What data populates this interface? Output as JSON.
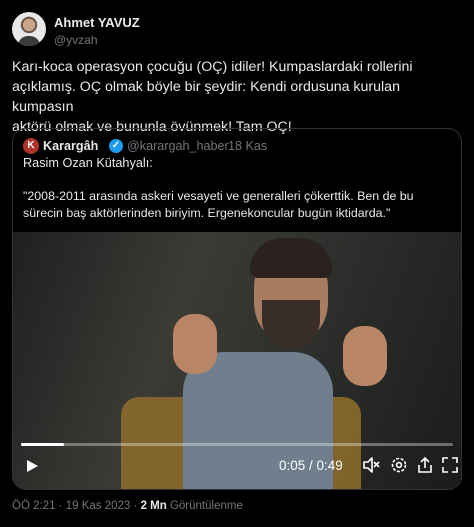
{
  "author": {
    "name": "Ahmet YAVUZ",
    "handle": "@yvzah"
  },
  "tweet": {
    "line1": "Karı-koca operasyon çocuğu (OÇ) idiler! Kumpaslardaki rollerini",
    "line2": "açıklamış. OÇ olmak böyle bir şeydir: Kendi ordusuna kurulan kumpasın",
    "line3": "aktörü olmak ve bununla övünmek! Tam OÇ!"
  },
  "quoted": {
    "logo_letter": "K",
    "name": "Karargâh",
    "verified_mark": "✓",
    "handle": "@karargah_haber",
    "separator": "·",
    "time": "18 Kas",
    "speaker": "Rasim Ozan Kütahyalı:",
    "quote_line1": "\"2008-2011 arasında askeri vesayeti ve generalleri çökerttik. Ben de bu",
    "quote_line2": "sürecin baş aktörlerinden biriyim. Ergenekoncular bugün iktidarda.\""
  },
  "video": {
    "time": "0:05 / 0:49",
    "progress": 0.1,
    "icons": [
      "play-icon",
      "mute-icon",
      "settings-icon",
      "share-icon",
      "fullscreen-icon"
    ]
  },
  "footer": {
    "time": "ÖÖ 2:21",
    "sep1": "·",
    "date": "19 Kas 2023",
    "sep2": "·",
    "views_count": "2 Mn",
    "views_label": "Görüntülenme"
  }
}
